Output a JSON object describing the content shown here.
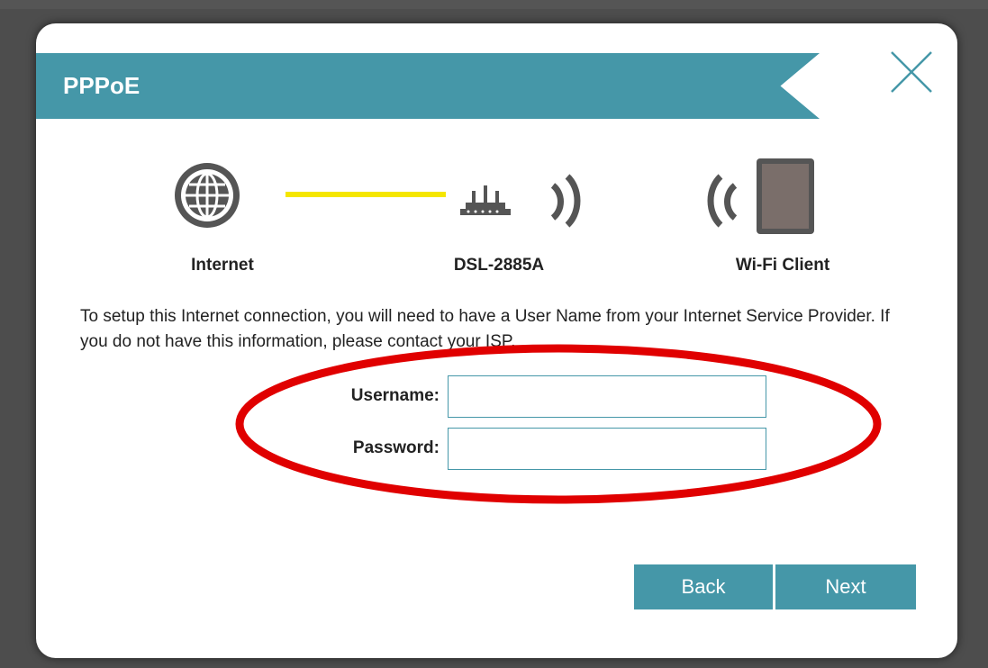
{
  "dialog": {
    "title": "PPPoE",
    "close_icon": "close-icon"
  },
  "diagram": {
    "nodes": [
      {
        "label": "Internet",
        "icon": "globe-icon"
      },
      {
        "label": "DSL-2885A",
        "icon": "router-icon"
      },
      {
        "label": "Wi-Fi Client",
        "icon": "tablet-icon"
      }
    ],
    "link_color": "#f5e600"
  },
  "info": {
    "text": "To setup this Internet connection, you will need to have a User Name from your Internet Service Provider. If you do not have this information, please contact your ISP."
  },
  "form": {
    "username_label": "Username:",
    "username_value": "",
    "password_label": "Password:",
    "password_value": ""
  },
  "buttons": {
    "back_label": "Back",
    "next_label": "Next"
  },
  "colors": {
    "accent": "#4597a8",
    "highlight": "#e00000"
  }
}
